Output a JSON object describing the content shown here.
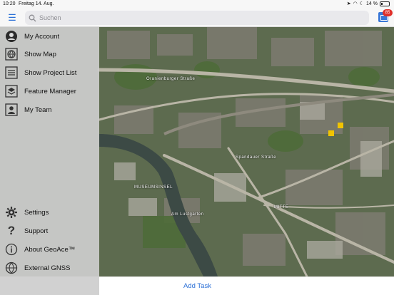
{
  "status_bar": {
    "time": "10:20",
    "date": "Freitag 14. Aug.",
    "battery": "14 %"
  },
  "search": {
    "placeholder": "Suchen"
  },
  "notifications": {
    "count": "85"
  },
  "sidebar": {
    "top_items": [
      {
        "label": "My Account",
        "icon": "account-icon"
      },
      {
        "label": "Show Map",
        "icon": "globe-icon"
      },
      {
        "label": "Show Project List",
        "icon": "list-icon"
      },
      {
        "label": "Feature Manager",
        "icon": "layers-icon"
      },
      {
        "label": "My Team",
        "icon": "person-icon"
      }
    ],
    "bottom_items": [
      {
        "label": "Settings",
        "icon": "gear-icon"
      },
      {
        "label": "Support",
        "icon": "question-icon"
      },
      {
        "label": "About GeoAce™",
        "icon": "info-icon"
      },
      {
        "label": "External GNSS",
        "icon": "satellite-icon"
      }
    ]
  },
  "map": {
    "labels": {
      "street_1": "Oranienburger Straße",
      "street_2": "Spandauer Straße",
      "district_1": "MUSEUMSINSEL",
      "district_2": "MITTE",
      "street_3": "Am Lustgarten"
    }
  },
  "footer": {
    "add_task": "Add Task"
  },
  "colors": {
    "accent": "#2a6fd6",
    "badge": "#e0302a"
  }
}
